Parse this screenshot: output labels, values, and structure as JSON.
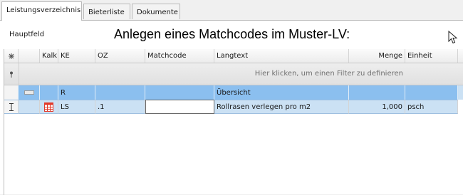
{
  "tabs": [
    {
      "label": "Leistungsverzeichnis",
      "active": true
    },
    {
      "label": "Bieterliste",
      "active": false
    },
    {
      "label": "Dokumente",
      "active": false
    }
  ],
  "panel": {
    "hauptfeld": "Hauptfeld",
    "heading": "Anlegen eines Matchcodes im Muster-LV:"
  },
  "table": {
    "columns": [
      "Kalk",
      "KE",
      "OZ",
      "Matchcode",
      "Langtext",
      "Menge",
      "Einheit"
    ],
    "filter_text": "Hier klicken, um einen Filter zu definieren",
    "group_row": {
      "ke": "R",
      "oz": "",
      "matchcode": "",
      "langtext": "Übersicht",
      "menge": "",
      "einheit": ""
    },
    "selected_row": {
      "kalk_icon": "calculation-table-icon",
      "ke": "LS",
      "oz": ".1",
      "matchcode": "",
      "langtext": "Rollrasen verlegen pro m2",
      "menge": "1,000",
      "einheit": "psch"
    }
  },
  "colors": {
    "group_row": "#cbe1f4",
    "group_highlight": "#8bbfef",
    "calc_icon": "#e23a2a"
  }
}
